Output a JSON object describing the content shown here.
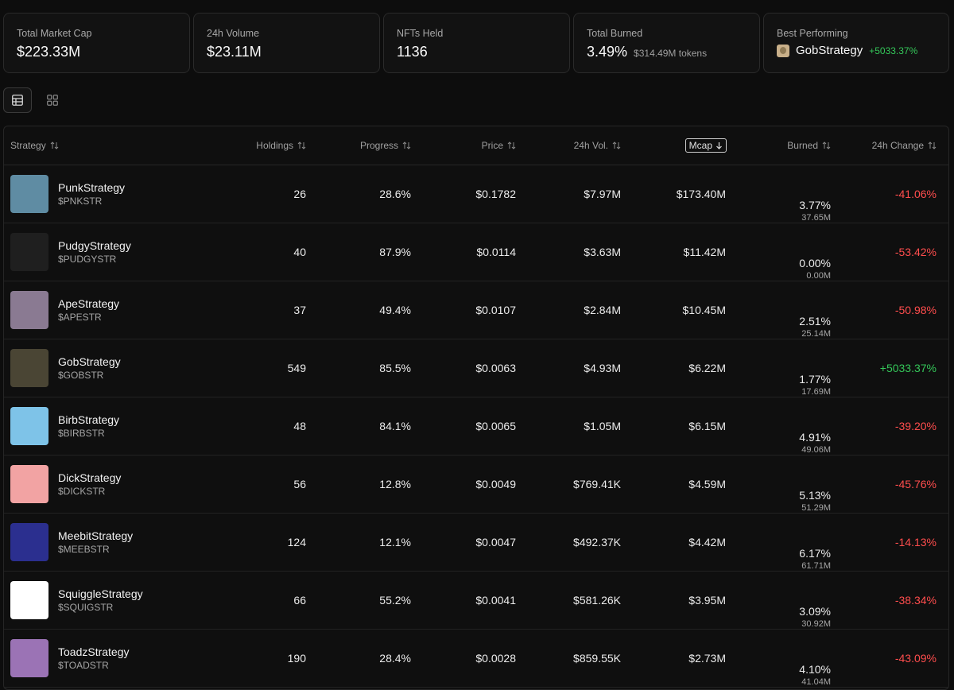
{
  "stats": [
    {
      "label": "Total Market Cap",
      "value": "$223.33M"
    },
    {
      "label": "24h Volume",
      "value": "$23.11M"
    },
    {
      "label": "NFTs Held",
      "value": "1136"
    },
    {
      "label": "Total Burned",
      "value": "3.49%",
      "sub": "$314.49M tokens"
    },
    {
      "label": "Best Performing",
      "name": "GobStrategy",
      "change": "+5033.37%"
    }
  ],
  "view_modes": [
    "table-icon",
    "grid-icon"
  ],
  "columns": {
    "strategy": "Strategy",
    "holdings": "Holdings",
    "progress": "Progress",
    "price": "Price",
    "volume": "24h Vol.",
    "mcap": "Mcap",
    "burned": "Burned",
    "change": "24h Change"
  },
  "rows": [
    {
      "name": "PunkStrategy",
      "ticker": "$PNKSTR",
      "holdings": "26",
      "progress": "28.6%",
      "price": "$0.1782",
      "volume": "$7.97M",
      "mcap": "$173.40M",
      "burned_pct": "3.77%",
      "burned_amt": "37.65M",
      "change": "-41.06%",
      "thumb_color": "#5f8ca3"
    },
    {
      "name": "PudgyStrategy",
      "ticker": "$PUDGYSTR",
      "holdings": "40",
      "progress": "87.9%",
      "price": "$0.0114",
      "volume": "$3.63M",
      "mcap": "$11.42M",
      "burned_pct": "0.00%",
      "burned_amt": "0.00M",
      "change": "-53.42%",
      "thumb_color": "#1f1f1f"
    },
    {
      "name": "ApeStrategy",
      "ticker": "$APESTR",
      "holdings": "37",
      "progress": "49.4%",
      "price": "$0.0107",
      "volume": "$2.84M",
      "mcap": "$10.45M",
      "burned_pct": "2.51%",
      "burned_amt": "25.14M",
      "change": "-50.98%",
      "thumb_color": "#8a7a92"
    },
    {
      "name": "GobStrategy",
      "ticker": "$GOBSTR",
      "holdings": "549",
      "progress": "85.5%",
      "price": "$0.0063",
      "volume": "$4.93M",
      "mcap": "$6.22M",
      "burned_pct": "1.77%",
      "burned_amt": "17.69M",
      "change": "+5033.37%",
      "thumb_color": "#4a4534"
    },
    {
      "name": "BirbStrategy",
      "ticker": "$BIRBSTR",
      "holdings": "48",
      "progress": "84.1%",
      "price": "$0.0065",
      "volume": "$1.05M",
      "mcap": "$6.15M",
      "burned_pct": "4.91%",
      "burned_amt": "49.06M",
      "change": "-39.20%",
      "thumb_color": "#7ec3e8"
    },
    {
      "name": "DickStrategy",
      "ticker": "$DICKSTR",
      "holdings": "56",
      "progress": "12.8%",
      "price": "$0.0049",
      "volume": "$769.41K",
      "mcap": "$4.59M",
      "burned_pct": "5.13%",
      "burned_amt": "51.29M",
      "change": "-45.76%",
      "thumb_color": "#f2a3a3"
    },
    {
      "name": "MeebitStrategy",
      "ticker": "$MEEBSTR",
      "holdings": "124",
      "progress": "12.1%",
      "price": "$0.0047",
      "volume": "$492.37K",
      "mcap": "$4.42M",
      "burned_pct": "6.17%",
      "burned_amt": "61.71M",
      "change": "-14.13%",
      "thumb_color": "#2b2f8f"
    },
    {
      "name": "SquiggleStrategy",
      "ticker": "$SQUIGSTR",
      "holdings": "66",
      "progress": "55.2%",
      "price": "$0.0041",
      "volume": "$581.26K",
      "mcap": "$3.95M",
      "burned_pct": "3.09%",
      "burned_amt": "30.92M",
      "change": "-38.34%",
      "thumb_color": "#ffffff"
    },
    {
      "name": "ToadzStrategy",
      "ticker": "$TOADSTR",
      "holdings": "190",
      "progress": "28.4%",
      "price": "$0.0028",
      "volume": "$859.55K",
      "mcap": "$2.73M",
      "burned_pct": "4.10%",
      "burned_amt": "41.04M",
      "change": "-43.09%",
      "thumb_color": "#9b73b5"
    }
  ],
  "colors": {
    "positive": "#34c759",
    "negative": "#ff4d4d",
    "background": "#0d0d0d"
  }
}
